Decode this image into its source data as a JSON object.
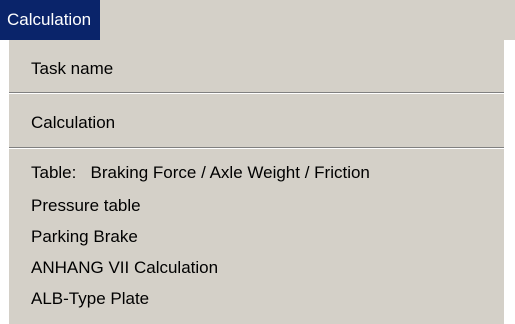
{
  "menu": {
    "title": "Calculation",
    "items": [
      {
        "label": "Task name"
      },
      {
        "label": "Calculation"
      },
      {
        "label": "Table:   Braking Force / Axle Weight / Friction"
      },
      {
        "label": "Pressure table"
      },
      {
        "label": "Parking Brake"
      },
      {
        "label": "ANHANG VII Calculation"
      },
      {
        "label": "ALB-Type Plate"
      }
    ]
  },
  "colors": {
    "highlight": "#0a246a",
    "menu_background": "#d4d0c8",
    "separator_shadow": "#808080",
    "separator_light": "#ffffff"
  }
}
